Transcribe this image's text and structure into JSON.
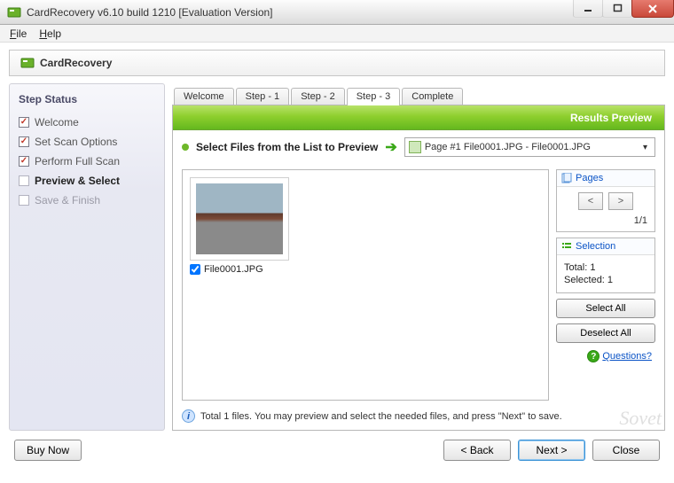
{
  "window": {
    "title": "CardRecovery v6.10 build 1210 [Evaluation Version]"
  },
  "menu": {
    "file": "File",
    "help": "Help"
  },
  "app_header": {
    "brand": "CardRecovery"
  },
  "sidebar": {
    "heading": "Step Status",
    "steps": [
      {
        "label": "Welcome",
        "state": "done"
      },
      {
        "label": "Set Scan Options",
        "state": "done"
      },
      {
        "label": "Perform Full Scan",
        "state": "done"
      },
      {
        "label": "Preview & Select",
        "state": "current"
      },
      {
        "label": "Save & Finish",
        "state": "future"
      }
    ]
  },
  "tabs": [
    {
      "label": "Welcome"
    },
    {
      "label": "Step - 1"
    },
    {
      "label": "Step - 2"
    },
    {
      "label": "Step - 3",
      "active": true
    },
    {
      "label": "Complete"
    }
  ],
  "banner": {
    "title": "Results Preview"
  },
  "toolbar": {
    "select_label": "Select Files from the List to Preview",
    "page_selector": "Page #1    File0001.JPG - File0001.JPG"
  },
  "thumbs": [
    {
      "caption": "File0001.JPG",
      "checked": true
    }
  ],
  "pages_box": {
    "title": "Pages",
    "prev": "<",
    "next": ">",
    "counter": "1/1"
  },
  "selection_box": {
    "title": "Selection",
    "total_label": "Total: 1",
    "selected_label": "Selected: 1",
    "select_all": "Select All",
    "deselect_all": "Deselect All"
  },
  "questions_link": "Questions?",
  "status_text": "Total 1 files.  You may preview and select the needed files, and press \"Next\" to save.",
  "buttons": {
    "buy": "Buy Now",
    "back": "< Back",
    "next": "Next >",
    "close": "Close"
  },
  "watermark": "Sovet"
}
